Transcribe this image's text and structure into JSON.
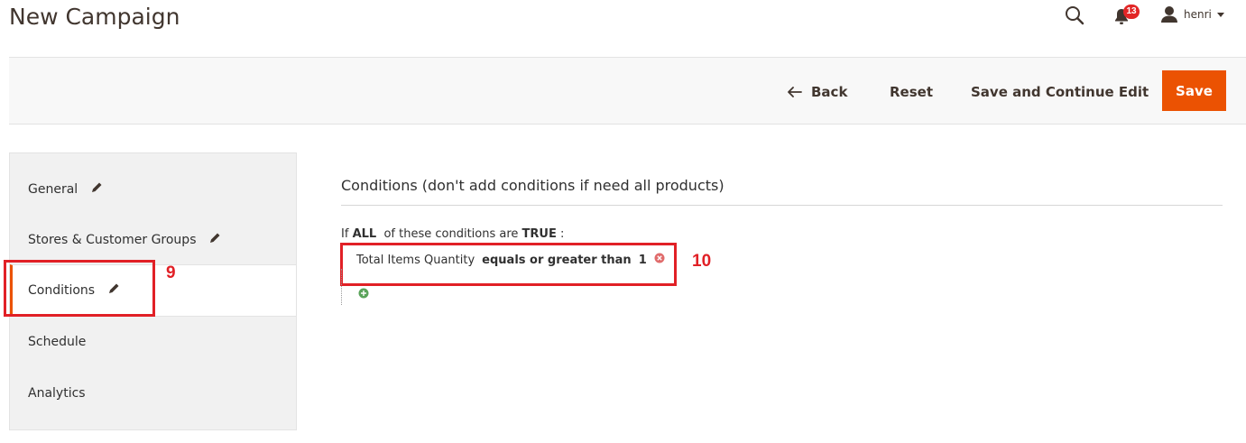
{
  "page": {
    "title": "New Campaign"
  },
  "header": {
    "search_icon": "search-icon",
    "notifications": {
      "icon": "bell-icon",
      "count": "13",
      "badge_color": "#e22626"
    },
    "user": {
      "name": "henri",
      "icon": "user-icon"
    }
  },
  "toolbar": {
    "back_label": "Back",
    "reset_label": "Reset",
    "save_continue_label": "Save and Continue Edit",
    "save_label": "Save",
    "save_color": "#eb5202"
  },
  "sidebar": {
    "items": [
      {
        "label": "General",
        "editable": true
      },
      {
        "label": "Stores & Customer Groups",
        "editable": true
      },
      {
        "label": "Conditions",
        "editable": true,
        "active": true
      },
      {
        "label": "Schedule",
        "editable": false
      },
      {
        "label": "Analytics",
        "editable": false
      }
    ]
  },
  "main": {
    "section_title": "Conditions (don't add conditions if need all products)",
    "condition_header": {
      "prefix": "If",
      "aggregator": "ALL",
      "middle": "of these conditions are",
      "value": "TRUE",
      "suffix": ":"
    },
    "rule": {
      "attribute": "Total Items Quantity",
      "operator": "equals or greater than",
      "value": "1"
    }
  },
  "annotations": [
    {
      "label": "9",
      "color": "#e12026"
    },
    {
      "label": "10",
      "color": "#e12026"
    }
  ]
}
